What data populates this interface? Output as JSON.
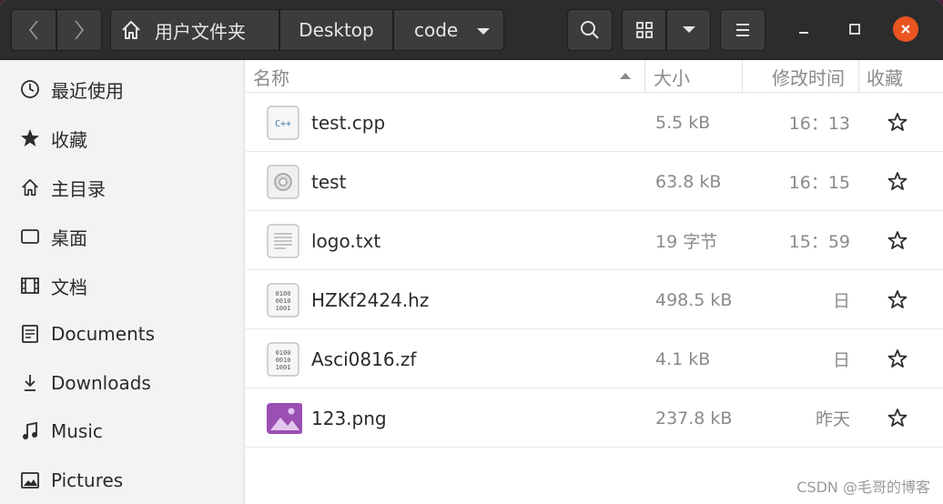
{
  "header": {
    "breadcrumbs": [
      "用户文件夹",
      "Desktop",
      "code"
    ]
  },
  "sidebar": {
    "items": [
      {
        "label": "最近使用",
        "icon": "clock-icon"
      },
      {
        "label": "收藏",
        "icon": "star-icon"
      },
      {
        "label": "主目录",
        "icon": "home-icon"
      },
      {
        "label": "桌面",
        "icon": "desktop-icon"
      },
      {
        "label": "文档",
        "icon": "film-icon"
      },
      {
        "label": "Documents",
        "icon": "document-icon"
      },
      {
        "label": "Downloads",
        "icon": "download-icon"
      },
      {
        "label": "Music",
        "icon": "music-icon"
      },
      {
        "label": "Pictures",
        "icon": "picture-icon"
      }
    ]
  },
  "filelist": {
    "columns": {
      "name": "名称",
      "size": "大小",
      "modified": "修改时间",
      "starred": "收藏"
    },
    "rows": [
      {
        "name": "test.cpp",
        "size": "5.5 kB",
        "modified": "16：13",
        "icon": "cpp-file-icon"
      },
      {
        "name": "test",
        "size": "63.8 kB",
        "modified": "16：15",
        "icon": "executable-icon"
      },
      {
        "name": "logo.txt",
        "size": "19 字节",
        "modified": "15：59",
        "icon": "text-file-icon"
      },
      {
        "name": "HZKf2424.hz",
        "size": "498.5 kB",
        "modified": "日",
        "icon": "binary-file-icon"
      },
      {
        "name": "Asci0816.zf",
        "size": "4.1 kB",
        "modified": "日",
        "icon": "binary-file-icon"
      },
      {
        "name": "123.png",
        "size": "237.8 kB",
        "modified": "昨天",
        "icon": "image-file-icon"
      }
    ]
  },
  "watermark": "CSDN @毛哥的博客",
  "colors": {
    "close": "#e95420",
    "header": "#2c2c2c",
    "image_icon": "#9b4fb3"
  }
}
